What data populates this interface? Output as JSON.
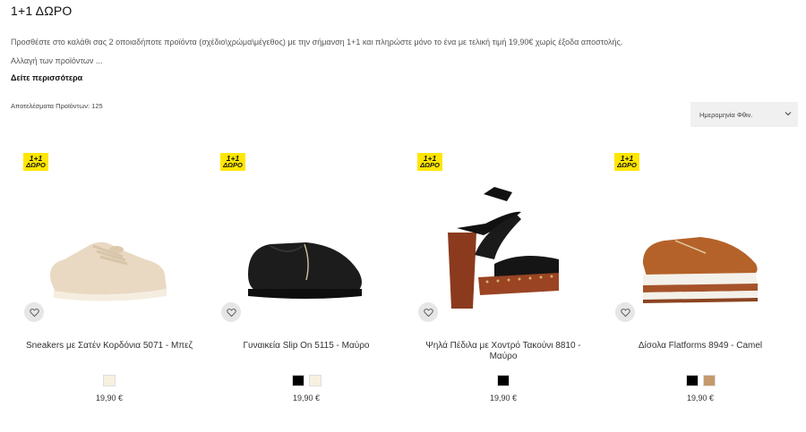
{
  "header": {
    "title": "1+1 ΔΩΡΟ",
    "promo": "Προσθέστε στο καλάθι σας 2 οποιαδήποτε προϊόντα (σχέδιο\\χρώμα\\μέγεθος) με την σήμανση 1+1 και πληρώστε μόνο το ένα με τελική τιμή 19,90€ χωρίς έξοδα αποστολής.",
    "change": "Αλλαγή των προϊόντων ...",
    "see_more": "Δείτε περισσότερα",
    "results": "Αποτελέσματα Προϊόντων: 125"
  },
  "sort": {
    "selected": "Ημερομηνία Φθιν.",
    "icon": "chevron-down-icon"
  },
  "badge": {
    "line1": "1+1",
    "line2": "ΔΩΡΟ",
    "color": "#ffe600"
  },
  "products": [
    {
      "name": "Sneakers με Σατέν Κορδόνια 5071 - Μπεζ",
      "price": "19,90 €",
      "swatches": [
        "#f7f1df"
      ]
    },
    {
      "name": "Γυναικεία Slip On 5115 - Μαύρο",
      "price": "19,90 €",
      "swatches": [
        "#000000",
        "#f7f1df"
      ]
    },
    {
      "name": "Ψηλά Πέδιλα με Χοντρό Τακούνι 8810 - Μαύρο",
      "price": "19,90 €",
      "swatches": [
        "#000000"
      ]
    },
    {
      "name": "Δίσολα Flatforms 8949 - Camel",
      "price": "19,90 €",
      "swatches": [
        "#000000",
        "#c49a6c"
      ]
    }
  ]
}
